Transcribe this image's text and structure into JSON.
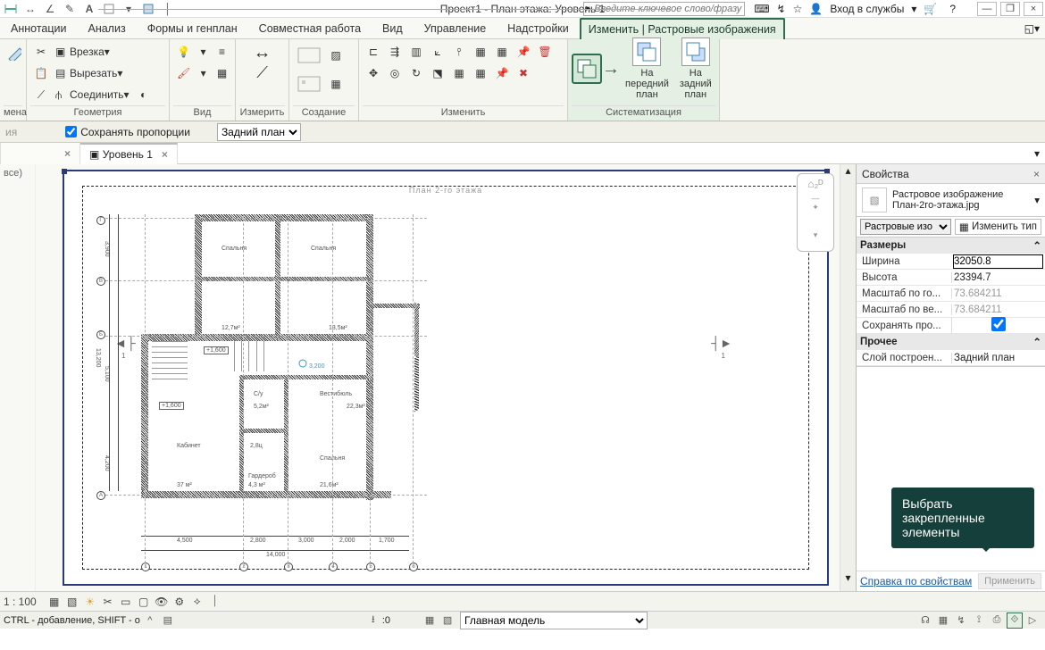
{
  "title": "Проект1 - План этажа: Уровень 1",
  "search_placeholder": "Введите ключевое слово/фразу",
  "login_label": "Вход в службы",
  "tabs": [
    "Аннотации",
    "Анализ",
    "Формы и генплан",
    "Совместная работа",
    "Вид",
    "Управление",
    "Надстройки",
    "Изменить | Растровые изображения"
  ],
  "ribbon": {
    "cut": "Врезка",
    "clip": "Вырезать",
    "join": "Соединить",
    "panels": {
      "geom": "Геометрия",
      "view": "Вид",
      "measure": "Измерить",
      "create": "Создание",
      "modify": "Изменить",
      "order": "Систематизация",
      "change": "мена"
    },
    "front": "На передний план",
    "back": "На задний план"
  },
  "options": {
    "truncated_left": "ия",
    "keep_prop": "Сохранять пропорции",
    "layer_sel": "Задний план"
  },
  "tabs_docs": [
    {
      "label": "",
      "close": "×"
    },
    {
      "label": "Уровень 1",
      "close": "×"
    }
  ],
  "left_truncated": "все)",
  "drawing": {
    "title": "План 2-го этажа",
    "rooms": {
      "bed1": "Спальня",
      "bed2": "Спальня",
      "bed3": "Спальня",
      "hall": "Вестибюль",
      "bath": "С/у",
      "office": "Кабинет",
      "closet": "Гардероб"
    },
    "dims": {
      "w": "14,000",
      "d1": "4,500",
      "d2": "2,800",
      "d3": "3,000",
      "d4": "2,000",
      "d5": "1,700",
      "h1": "3,900",
      "h2": "5,100",
      "h3": "4,200",
      "h4": "13,200",
      "lv": "+1,600"
    },
    "areas": {
      "a1": "12,7м²",
      "a2": "13,5м²",
      "a3": "22,3м²",
      "a4": "5,2м²",
      "a5": "2,8ц",
      "a6": "37 м²",
      "a7": "4,3 м²",
      "a8": "21,6м²"
    },
    "level_mark": "3,200",
    "axes_h": [
      "А",
      "Б",
      "В",
      "Г"
    ],
    "axes_v": [
      "1",
      "2",
      "3",
      "4",
      "5",
      "6"
    ]
  },
  "viewbar": {
    "scale": "1 : 100",
    "model": "Главная модель"
  },
  "properties": {
    "title": "Свойства",
    "type_name": "Растровое изображение\nПлан-2го-этажа.jpg",
    "filter": "Растровые изо",
    "edit_type": "Изменить тип",
    "sections": {
      "sizes": "Размеры",
      "other": "Прочее"
    },
    "rows": {
      "width": {
        "k": "Ширина",
        "v": "32050.8"
      },
      "height": {
        "k": "Высота",
        "v": "23394.7"
      },
      "scale_h": {
        "k": "Масштаб по го...",
        "v": "73.684211"
      },
      "scale_v": {
        "k": "Масштаб по ве...",
        "v": "73.684211"
      },
      "lock": {
        "k": "Сохранять про...",
        "v": true
      },
      "layer": {
        "k": "Слой построен...",
        "v": "Задний план"
      }
    },
    "help": "Справка по свойствам",
    "apply": "Применить"
  },
  "tooltip": "Выбрать закрепленные элементы",
  "status": {
    "left": "CTRL - добавление, SHIFT - о",
    "zero": ":0"
  }
}
